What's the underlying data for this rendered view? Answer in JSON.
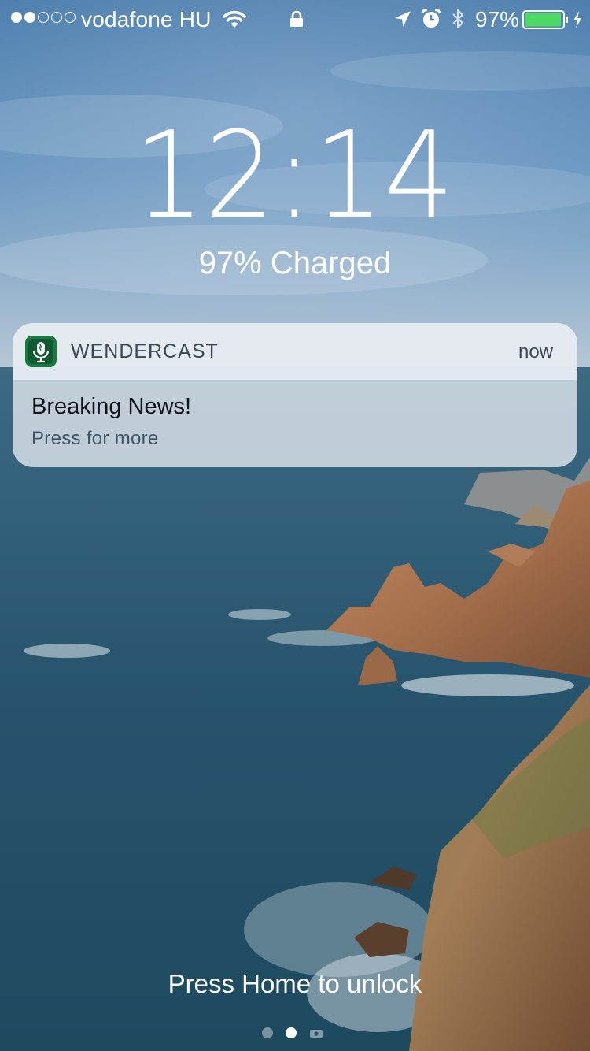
{
  "status_bar": {
    "signal_filled": 2,
    "signal_total": 5,
    "carrier": "vodafone HU",
    "wifi_icon": "wifi-icon",
    "lock_icon": "lock-icon",
    "location_icon": "location-arrow-icon",
    "alarm_icon": "alarm-clock-icon",
    "bluetooth_icon": "bluetooth-icon",
    "battery_percent": "97%",
    "battery_level": 0.97,
    "battery_color": "#4cd964",
    "charging_icon": "charging-bolt-icon"
  },
  "lock_screen": {
    "time": "12:14",
    "charge_status": "97% Charged"
  },
  "notification": {
    "app_icon": "microphone-icon",
    "app_icon_color": "#1a7a43",
    "app_name": "WENDERCAST",
    "time": "now",
    "title": "Breaking News!",
    "subtitle": "Press for more"
  },
  "bottom": {
    "unlock_hint": "Press Home to unlock",
    "pages": 3,
    "active_page": 1
  }
}
